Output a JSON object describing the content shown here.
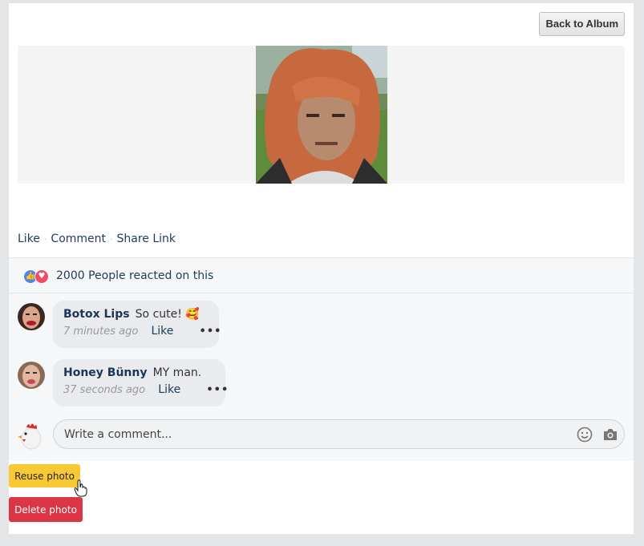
{
  "header": {
    "back_label": "Back to Album"
  },
  "actions": {
    "like": "Like",
    "comment": "Comment",
    "share": "Share Link"
  },
  "reactions": {
    "text": "2000 People reacted on this"
  },
  "comments": [
    {
      "author": "Botox Lips",
      "text": "So cute! 🥰",
      "time": "7 minutes ago",
      "like": "Like",
      "more": "•••"
    },
    {
      "author": "Honey Bünny",
      "text": "MY man.",
      "time": "37 seconds ago",
      "like": "Like",
      "more": "•••"
    }
  ],
  "composer": {
    "placeholder": "Write a comment..."
  },
  "buttons": {
    "reuse": "Reuse photo",
    "delete": "Delete photo"
  },
  "colors": {
    "reuse_bg": "#f8c933",
    "delete_bg": "#dc3545",
    "like_blue": "#4e84f0",
    "love_red": "#ee4e63"
  },
  "icons": [
    "like-reaction-icon",
    "love-reaction-icon",
    "emoji-icon",
    "camera-icon",
    "chicken-avatar-icon",
    "hand-cursor-icon"
  ]
}
